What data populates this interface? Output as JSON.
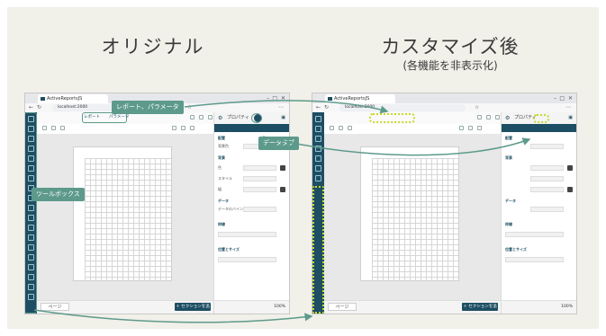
{
  "headings": {
    "original": "オリジナル",
    "customized": "カスタマイズ後",
    "customized_sub": "(各機能を非表示化)"
  },
  "callouts": {
    "report_params": "レポート、パラメータ",
    "data_tab": "データタブ",
    "toolbox": "ツールボックス"
  },
  "original": {
    "browser_tab": "ActiveReportsJS",
    "url": "localhost:2000",
    "toolbar_tabs": [
      "レポート",
      "パラメータ"
    ],
    "panel_tabs": [
      "プロパティ",
      "データ"
    ],
    "sections": [
      "配置",
      "背景",
      "データ",
      "枠線",
      "位置とサイズ"
    ],
    "rows": [
      {
        "label": "背景色",
        "value": "Transparent"
      },
      {
        "label": "色",
        "value": "Red"
      },
      {
        "label": "スタイル",
        "value": "Solid"
      },
      {
        "label": "幅",
        "value": "1pt"
      },
      {
        "label": "データのバインディング",
        "value": "なし"
      }
    ],
    "page_tab": "ページ",
    "add_section": "＋ セクションを追加",
    "zoom": "100%"
  },
  "customized": {
    "browser_tab": "ActiveReportsJS",
    "url": "localhost:2000",
    "panel_tabs": [
      "プロパティ"
    ],
    "sections": [
      "配置",
      "背景",
      "データ",
      "枠線",
      "位置とサイズ"
    ],
    "page_tab": "ページ",
    "add_section": "＋ セクションを追加",
    "zoom": "100%"
  },
  "colors": {
    "background": "#f1f0e9",
    "brand": "#1d4e63",
    "callout": "#5d9a8b",
    "hidden_highlight": "#c8d92a",
    "arrow": "#5d9a8b"
  }
}
